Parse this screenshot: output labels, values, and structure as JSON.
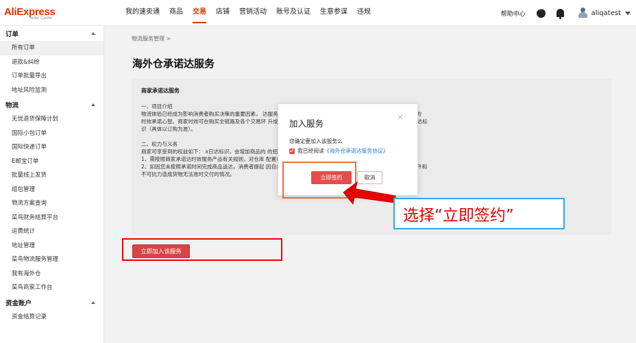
{
  "header": {
    "logo_main": "AliExpress",
    "logo_sub": "Seller Center",
    "nav": [
      {
        "label": "我的速卖通"
      },
      {
        "label": "商品"
      },
      {
        "label": "交易"
      },
      {
        "label": "店铺"
      },
      {
        "label": "营销活动"
      },
      {
        "label": "账号及认证"
      },
      {
        "label": "生意参谋"
      },
      {
        "label": "违规"
      }
    ],
    "active_nav": "交易",
    "help": "帮助中心",
    "username": "aliqatest",
    "icons": [
      "chat-icon",
      "bell-icon",
      "avatar",
      "caret-down-icon"
    ]
  },
  "sidebar": {
    "groups": [
      {
        "title": "订单",
        "items": [
          "所有订单",
          "退款&纠纷",
          "订单批量导出",
          "地址风险监测"
        ]
      },
      {
        "title": "物流",
        "items": [
          "无忧退货保障计划",
          "国际小包订单",
          "国际快递订单",
          "E邮宝订单",
          "批量线上发货",
          "组包管理",
          "物流方案查询",
          "菜鸟财务结算平台",
          "运费统计",
          "地址管理",
          "菜鸟物流服务管理",
          "我有海外仓",
          "菜鸟商家工作台"
        ]
      },
      {
        "title": "资金账户",
        "items": [
          "资金结算记录"
        ]
      }
    ]
  },
  "main": {
    "breadcrumb": "物流服务管理  >",
    "title": "海外仓承诺达服务",
    "panel": {
      "heading": "商家承诺达服务",
      "lines": [
        "一、项目介绍",
        "  物流体验已经成为影响消费者购买决策的重要因素，                                                                            达服务”，对商家在发货、到货等时效能力进行表达，强化消费者端的",
        "时效承诺心智。商家时效可在购买全链路及各个交易环                                                                            升成交转化。商家参与项目的商品，根据订购服务内容可获得X日达标",
        "识（具体以订购为准）。",
        "",
        "二、权力与义务",
        " 商家可享受到的权益如下： x日达标识，会增加商品的                                                                          的招商和坑位  商家需履约的义务（包含不限于）如下：",
        "1、需按照商家承诺达时效服务产品有关规则，对仓库                                                                              配置以系统提示为准。",
        "2、如因您未按照承诺时间完成商品送达，消费者提起                                                                              因自然灾害、意外事件（罢工、暴动、民众骚乱等）及其他意外事件和",
        "不可抗力造成货物无法准时交付的情况。"
      ]
    },
    "join_button": "立即加入该服务"
  },
  "modal": {
    "title": "加入服务",
    "close": "×",
    "confirm_text": "您确定要加入该服务么",
    "agree_prefix": "我已经阅读",
    "agree_link": "《海外仓承诺达服务协议》",
    "sign_button": "立即签约",
    "cancel_button": "取消"
  },
  "annotation": {
    "callout": "选择“立即签约”"
  }
}
